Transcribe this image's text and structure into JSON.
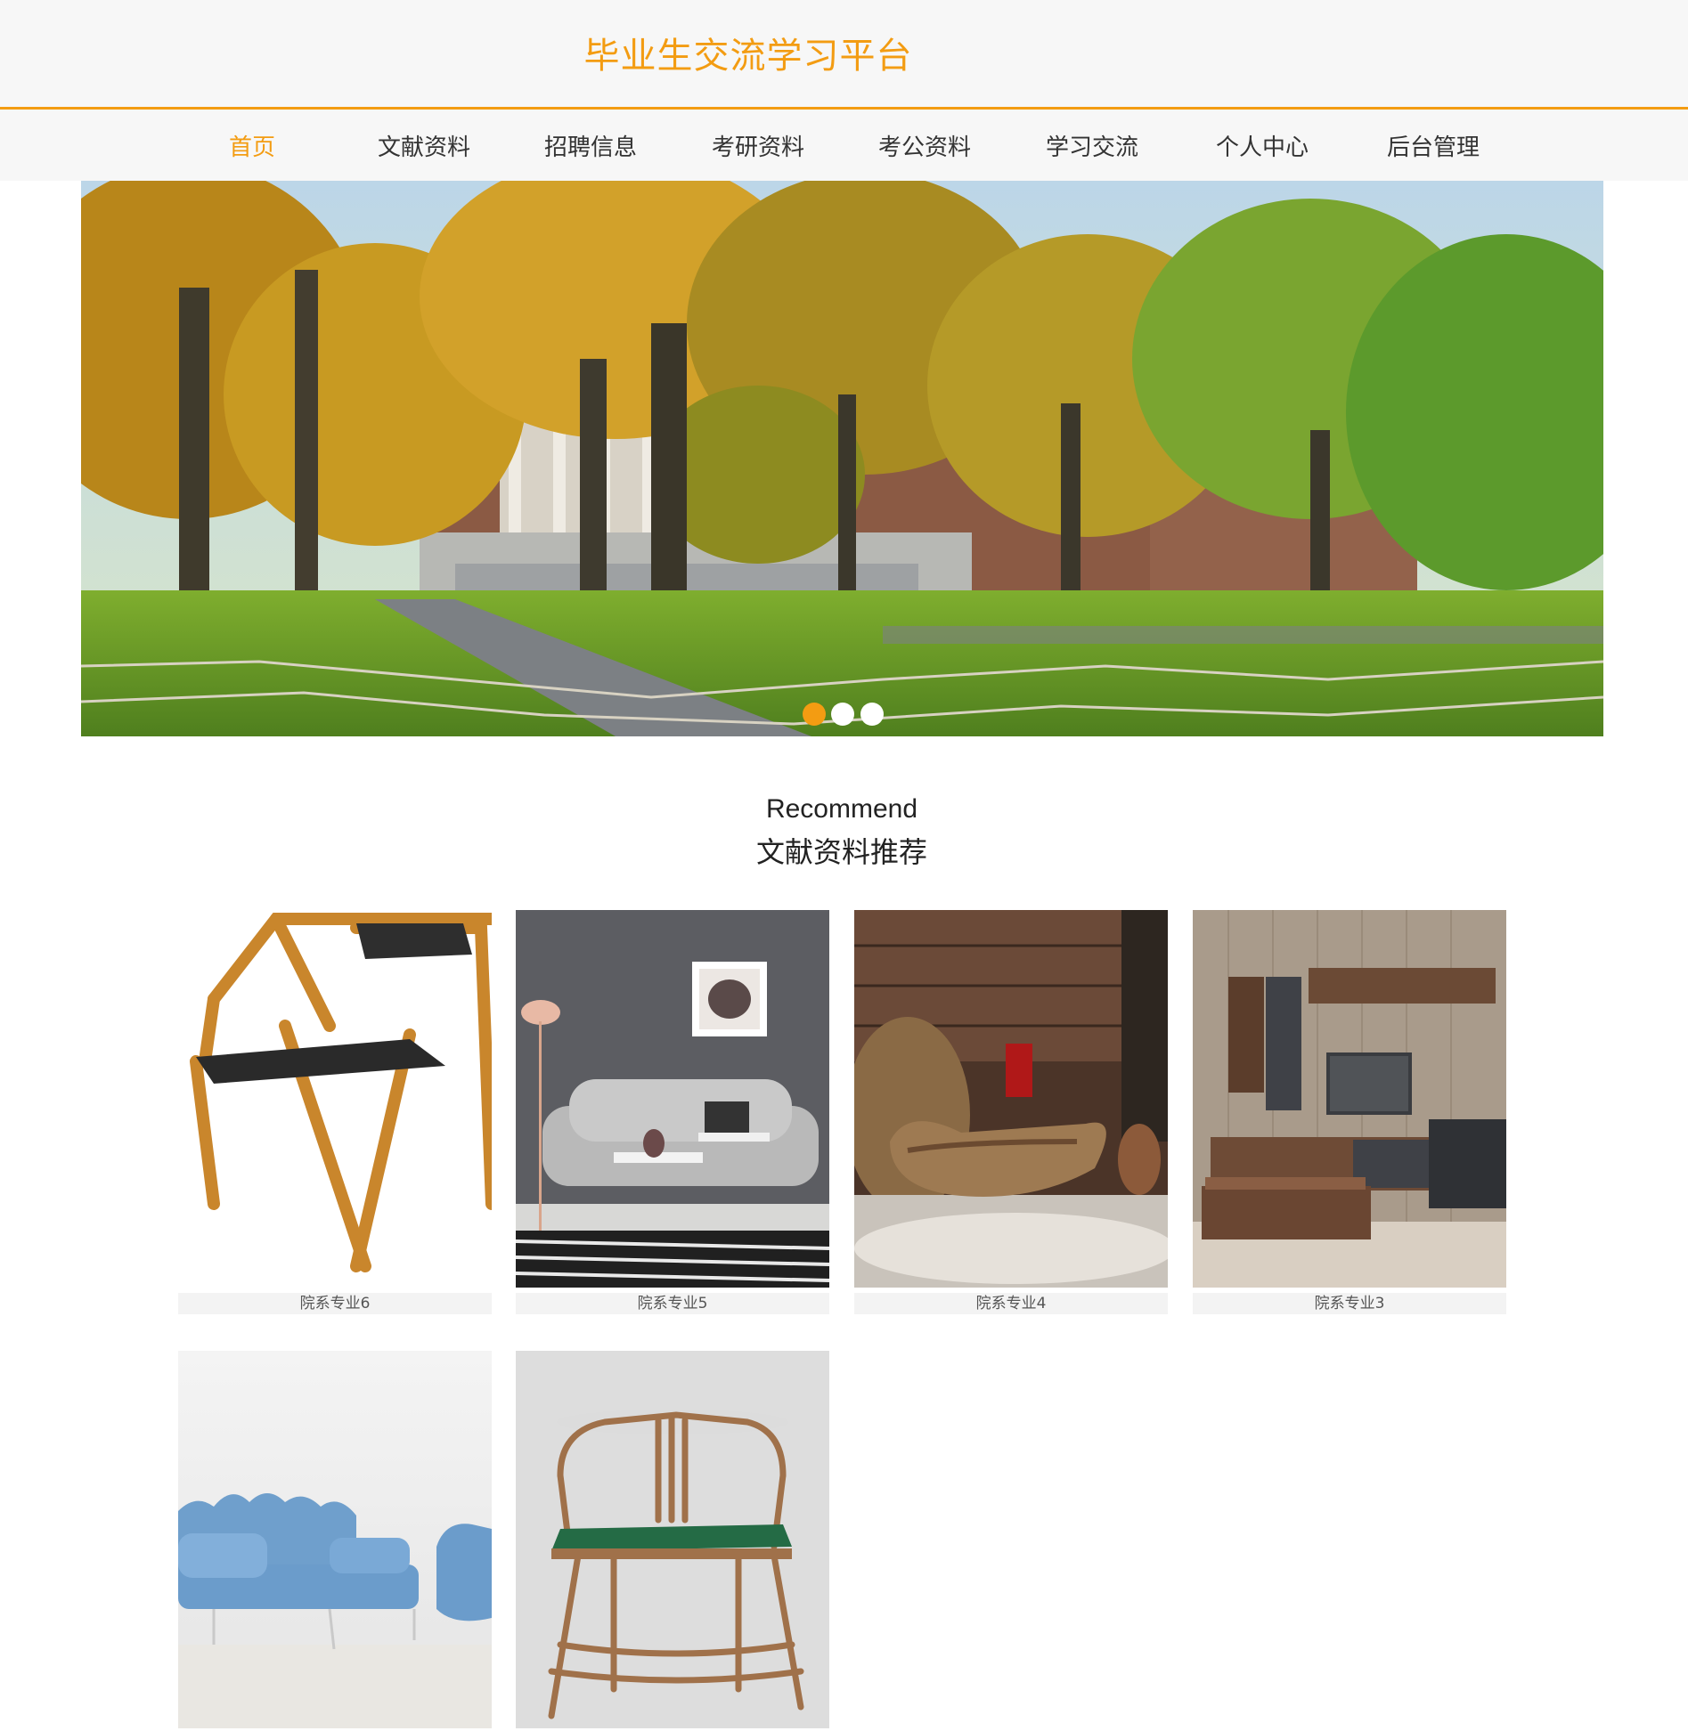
{
  "header": {
    "title": "毕业生交流学习平台"
  },
  "nav": {
    "items": [
      {
        "label": "首页",
        "active": true
      },
      {
        "label": "文献资料",
        "active": false
      },
      {
        "label": "招聘信息",
        "active": false
      },
      {
        "label": "考研资料",
        "active": false
      },
      {
        "label": "考公资料",
        "active": false
      },
      {
        "label": "学习交流",
        "active": false
      },
      {
        "label": "个人中心",
        "active": false
      },
      {
        "label": "后台管理",
        "active": false
      }
    ]
  },
  "banner": {
    "image": "campus-autumn-trees-photo",
    "slides": 3,
    "active_slide": 1
  },
  "section": {
    "title_en": "Recommend",
    "title_zh": "文献资料推荐"
  },
  "cards": [
    {
      "caption": "院系专业6",
      "image": "wooden-chair-photo"
    },
    {
      "caption": "院系专业5",
      "image": "grey-sofa-living-room-photo"
    },
    {
      "caption": "院系专业4",
      "image": "baroque-chaise-lounge-photo"
    },
    {
      "caption": "院系专业3",
      "image": "tv-cabinet-wall-photo"
    },
    {
      "caption": "",
      "image": "blue-sofa-photo"
    },
    {
      "caption": "",
      "image": "chinese-armchair-photo"
    }
  ],
  "colors": {
    "accent": "#f39c12",
    "header_bg": "#f7f7f7",
    "text": "#333333"
  }
}
